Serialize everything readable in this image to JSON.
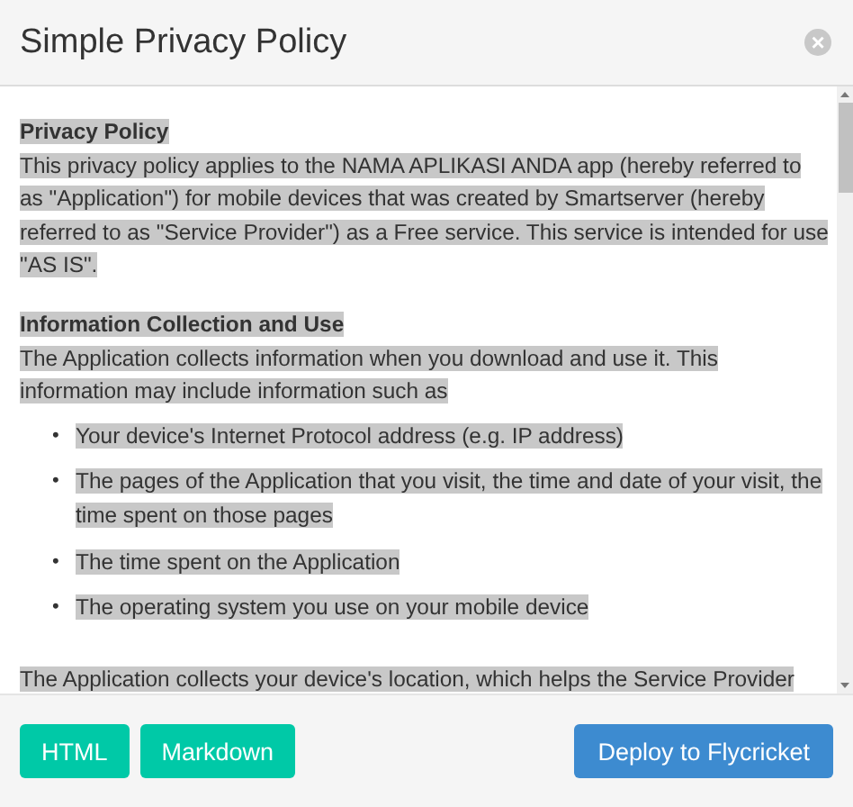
{
  "dialog": {
    "title": "Simple Privacy Policy",
    "close_icon": "×"
  },
  "content": {
    "selected": true,
    "blocks": [
      {
        "kind": "heading",
        "text": "Privacy Policy"
      },
      {
        "kind": "paragraph",
        "text": "This privacy policy applies to the NAMA APLIKASI ANDA app (hereby referred to as \"Application\") for mobile devices that was created by Smartserver (hereby referred to as \"Service Provider\") as a Free service. This service is intended for use \"AS IS\"."
      },
      {
        "kind": "heading",
        "text": "Information Collection and Use"
      },
      {
        "kind": "paragraph",
        "text": "The Application collects information when you download and use it. This information may include information such as"
      },
      {
        "kind": "list",
        "marker": "•",
        "items": [
          "Your device's Internet Protocol address (e.g. IP address)",
          "The pages of the Application that you visit, the time and date of your visit, the time spent on those pages",
          "The time spent on the Application",
          "The operating system you use on your mobile device"
        ]
      },
      {
        "kind": "paragraph",
        "text": "The Application collects your device's location, which helps the Service Provider"
      }
    ]
  },
  "buttons": [
    {
      "label": "HTML",
      "kind": "export"
    },
    {
      "label": "Markdown",
      "kind": "export"
    },
    {
      "label": "Deploy to Flycricket",
      "kind": "deploy"
    }
  ]
}
